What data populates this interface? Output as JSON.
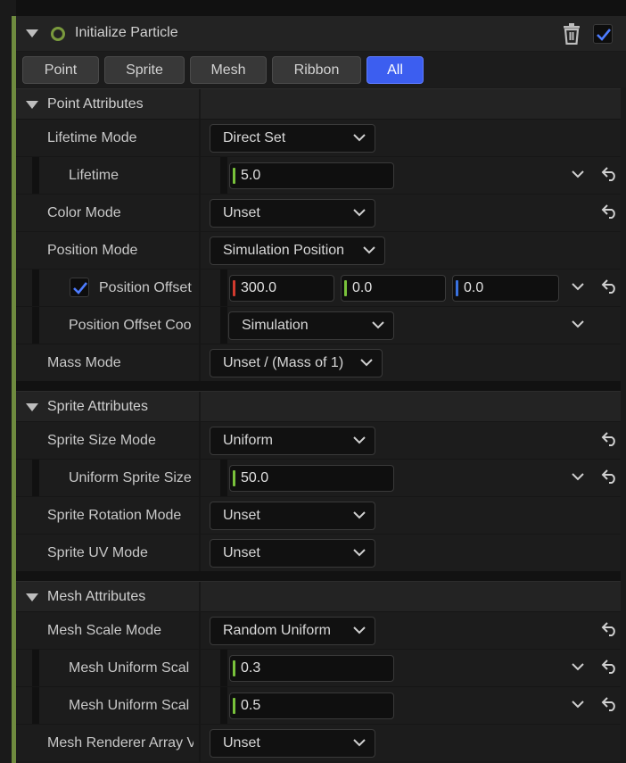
{
  "header": {
    "title": "Initialize Particle",
    "icons": [
      "collapse-triangle-icon",
      "status-ring-icon",
      "trash-icon",
      "enabled-checkbox-icon"
    ],
    "enabled": true
  },
  "tabs": [
    {
      "label": "Point",
      "active": false
    },
    {
      "label": "Sprite",
      "active": false
    },
    {
      "label": "Mesh",
      "active": false
    },
    {
      "label": "Ribbon",
      "active": false
    },
    {
      "label": "All",
      "active": true
    }
  ],
  "colors": {
    "accent": "#6f8b3f",
    "tab_active": "#3c5ef0",
    "x_channel": "#d23a2e",
    "y_channel": "#79c23b",
    "z_channel": "#3a72e0",
    "scalar_channel": "#79c23b"
  },
  "point": {
    "title": "Point Attributes",
    "lifetime_mode": {
      "label": "Lifetime Mode",
      "value": "Direct Set"
    },
    "lifetime": {
      "label": "Lifetime",
      "value": "5.0"
    },
    "color_mode": {
      "label": "Color Mode",
      "value": "Unset"
    },
    "position_mode": {
      "label": "Position Mode",
      "value": "Simulation Position"
    },
    "position_offset": {
      "label": "Position Offset",
      "checked": true,
      "x": "300.0",
      "y": "0.0",
      "z": "0.0"
    },
    "position_offset_coord": {
      "label": "Position Offset Coo",
      "value": "Simulation"
    },
    "mass_mode": {
      "label": "Mass Mode",
      "value": "Unset / (Mass of 1)"
    }
  },
  "sprite": {
    "title": "Sprite Attributes",
    "size_mode": {
      "label": "Sprite Size Mode",
      "value": "Uniform"
    },
    "uniform_size": {
      "label": "Uniform Sprite Size",
      "value": "50.0"
    },
    "rotation_mode": {
      "label": "Sprite Rotation Mode",
      "value": "Unset"
    },
    "uv_mode": {
      "label": "Sprite UV Mode",
      "value": "Unset"
    }
  },
  "mesh": {
    "title": "Mesh Attributes",
    "scale_mode": {
      "label": "Mesh Scale Mode",
      "value": "Random Uniform"
    },
    "uniform_scale_a": {
      "label": "Mesh Uniform Scal",
      "value": "0.3"
    },
    "uniform_scale_b": {
      "label": "Mesh Uniform Scal",
      "value": "0.5"
    },
    "renderer_array": {
      "label": "Mesh Renderer Array V",
      "value": "Unset"
    }
  }
}
